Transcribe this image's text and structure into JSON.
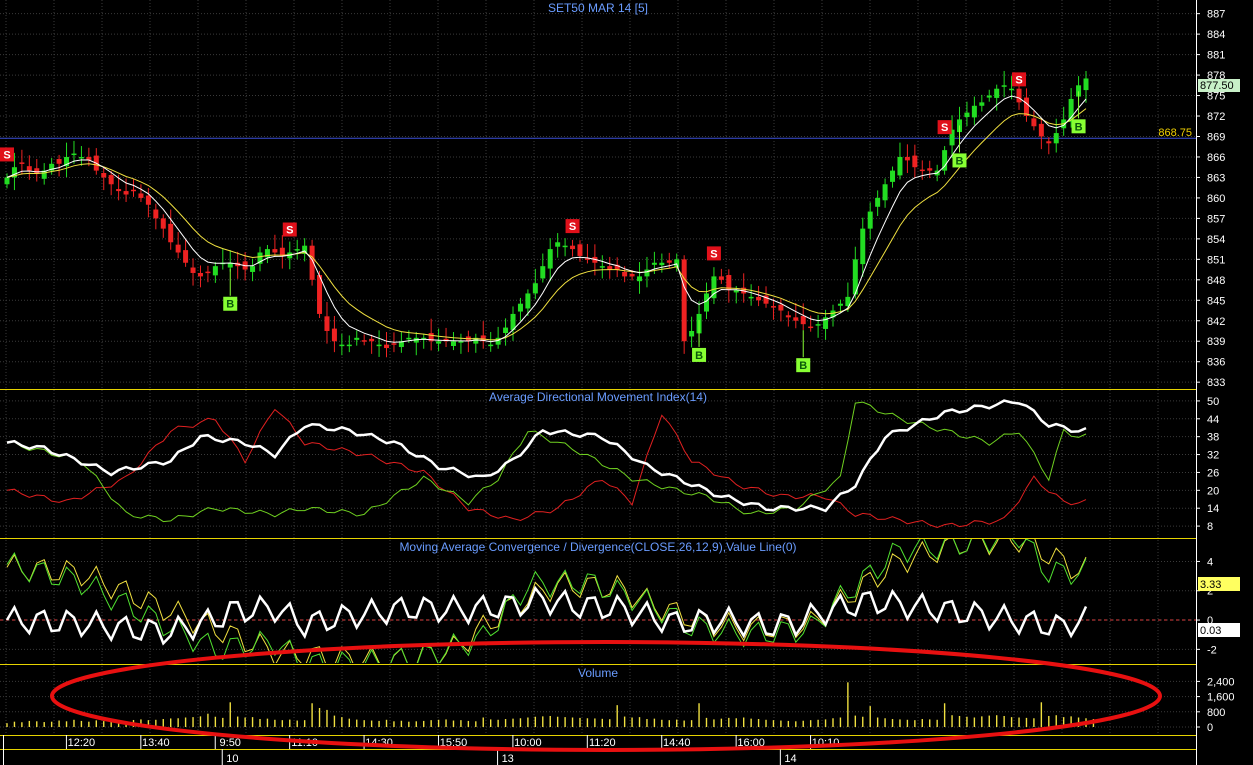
{
  "colors": {
    "background": "#000000",
    "grid": "#3a3a3a",
    "separator": "#e6d300",
    "bull": "#22dd22",
    "bear": "#ee2222",
    "ma_fast": "#ffffff",
    "ma_slow": "#f0e040",
    "title": "#6a9cff",
    "ref_line": "#3b4fd8",
    "sell_marker": "#e0101a",
    "buy_marker": "#88ff33",
    "highlight_ellipse": "#e81010",
    "price_tag_bg": "#c8f0c8",
    "macd_tag_bg": "#ffff60",
    "zero_tag_bg": "#ffffff"
  },
  "chart_data": [
    {
      "type": "candlestick",
      "panel": "price",
      "title": "SET50 MAR 14  [5]",
      "ylim": [
        832,
        889
      ],
      "yticks": [
        887,
        884,
        881,
        878,
        875,
        872,
        869,
        866,
        863,
        860,
        857,
        854,
        851,
        848,
        845,
        842,
        839,
        836,
        833
      ],
      "last_price_label": "877.50",
      "reference_level": 868.75,
      "reference_label": "868.75",
      "close": [
        863,
        864.5,
        865,
        864,
        863.5,
        864,
        865,
        865,
        866,
        866.5,
        866,
        865.5,
        864,
        863,
        862,
        861,
        860.5,
        861,
        860,
        859,
        857,
        855.5,
        853.5,
        852,
        850.5,
        849,
        848.5,
        849,
        850,
        850.5,
        850.5,
        850,
        849.5,
        850,
        852,
        852.5,
        852,
        851.5,
        852,
        852.5,
        853,
        848,
        843,
        840.5,
        839,
        838.5,
        838.5,
        839.5,
        839,
        839,
        838.5,
        838,
        838.5,
        839,
        839.5,
        839.5,
        839.5,
        839,
        839,
        839,
        839,
        839,
        839,
        839.5,
        839,
        838.5,
        839.5,
        841,
        843,
        844.5,
        846,
        847.5,
        850,
        852.5,
        853.5,
        853,
        852.5,
        851.5,
        851,
        850.5,
        850,
        849.5,
        849.5,
        848.5,
        848.5,
        848.5,
        849.5,
        850.5,
        850.5,
        850.5,
        851,
        839,
        840.5,
        843,
        846,
        848.5,
        848,
        846.5,
        846.5,
        846,
        845.5,
        845,
        844.5,
        844,
        843.5,
        842.5,
        842,
        841.5,
        841,
        841.5,
        842.5,
        843.5,
        844.5,
        845.5,
        851,
        855.5,
        858,
        860,
        862,
        864,
        866,
        865.5,
        864.5,
        864,
        864,
        864,
        867,
        870,
        871.5,
        872.5,
        873.5,
        874,
        875,
        876,
        876.5,
        876,
        874,
        872,
        870.5,
        869,
        868,
        869.5,
        871.5,
        874.5,
        876.5,
        877.5
      ],
      "volume": [
        200,
        280,
        250,
        320,
        300,
        260,
        280,
        340,
        300,
        380,
        320,
        280,
        350,
        310,
        390,
        340,
        310,
        370,
        400,
        360,
        380,
        420,
        450,
        460,
        500,
        520,
        560,
        700,
        540,
        480,
        1300,
        550,
        500,
        520,
        420,
        440,
        380,
        360,
        390,
        340,
        360,
        1250,
        1000,
        900,
        600,
        520,
        440,
        390,
        360,
        340,
        320,
        380,
        300,
        330,
        280,
        300,
        320,
        360,
        380,
        400,
        340,
        360,
        320,
        300,
        500,
        400,
        380,
        420,
        440,
        460,
        500,
        540,
        560,
        580,
        540,
        520,
        500,
        480,
        460,
        450,
        430,
        410,
        1150,
        550,
        500,
        520,
        420,
        440,
        380,
        360,
        390,
        340,
        360,
        1250,
        480,
        400,
        440,
        480,
        460,
        500,
        440,
        420,
        380,
        360,
        340,
        320,
        300,
        330,
        360,
        380,
        400,
        460,
        500,
        2350,
        600,
        540,
        1100,
        500,
        460,
        420,
        400,
        380,
        360,
        420,
        400,
        380,
        1250,
        620,
        580,
        540,
        500,
        560,
        600,
        620,
        580,
        520,
        500,
        480,
        460,
        1300,
        580,
        620,
        520,
        560,
        500,
        460,
        420
      ],
      "markers": [
        {
          "label": "S",
          "kind": "sell",
          "index": 0
        },
        {
          "label": "B",
          "kind": "buy",
          "index": 30
        },
        {
          "label": "S",
          "kind": "sell",
          "index": 38
        },
        {
          "label": "S",
          "kind": "sell",
          "index": 76
        },
        {
          "label": "S",
          "kind": "sell",
          "index": 95
        },
        {
          "label": "B",
          "kind": "buy",
          "index": 93
        },
        {
          "label": "B",
          "kind": "buy",
          "index": 107
        },
        {
          "label": "S",
          "kind": "sell",
          "index": 126
        },
        {
          "label": "B",
          "kind": "buy",
          "index": 128
        },
        {
          "label": "S",
          "kind": "sell",
          "index": 136
        },
        {
          "label": "B",
          "kind": "buy",
          "index": 144
        }
      ]
    },
    {
      "type": "line",
      "panel": "adx",
      "title": "Average Directional Movement Index(14)",
      "ylim": [
        4,
        54
      ],
      "yticks": [
        50,
        44,
        38,
        32,
        26,
        20,
        14,
        8
      ],
      "adx_keypoints": [
        [
          0,
          36
        ],
        [
          5,
          34
        ],
        [
          14,
          26
        ],
        [
          22,
          30
        ],
        [
          26,
          38
        ],
        [
          32,
          36
        ],
        [
          36,
          32
        ],
        [
          40,
          42
        ],
        [
          46,
          40
        ],
        [
          52,
          36
        ],
        [
          58,
          28
        ],
        [
          64,
          24
        ],
        [
          68,
          30
        ],
        [
          72,
          40
        ],
        [
          80,
          38
        ],
        [
          86,
          28
        ],
        [
          90,
          24
        ],
        [
          96,
          18
        ],
        [
          102,
          14
        ],
        [
          110,
          14
        ],
        [
          114,
          22
        ],
        [
          118,
          38
        ],
        [
          126,
          46
        ],
        [
          136,
          50
        ],
        [
          140,
          42
        ],
        [
          144,
          40
        ]
      ],
      "plus_di_keypoints": [
        [
          0,
          36
        ],
        [
          10,
          30
        ],
        [
          16,
          12
        ],
        [
          22,
          10
        ],
        [
          28,
          14
        ],
        [
          36,
          12
        ],
        [
          40,
          14
        ],
        [
          48,
          12
        ],
        [
          56,
          24
        ],
        [
          62,
          16
        ],
        [
          66,
          24
        ],
        [
          70,
          40
        ],
        [
          76,
          34
        ],
        [
          84,
          24
        ],
        [
          90,
          20
        ],
        [
          94,
          18
        ],
        [
          100,
          12
        ],
        [
          106,
          14
        ],
        [
          112,
          24
        ],
        [
          114,
          50
        ],
        [
          120,
          44
        ],
        [
          126,
          40
        ],
        [
          132,
          36
        ],
        [
          136,
          40
        ],
        [
          140,
          24
        ],
        [
          142,
          40
        ],
        [
          144,
          38
        ]
      ],
      "minus_di_keypoints": [
        [
          0,
          20
        ],
        [
          8,
          16
        ],
        [
          16,
          24
        ],
        [
          22,
          40
        ],
        [
          28,
          44
        ],
        [
          32,
          30
        ],
        [
          36,
          48
        ],
        [
          40,
          36
        ],
        [
          48,
          32
        ],
        [
          56,
          26
        ],
        [
          62,
          14
        ],
        [
          68,
          10
        ],
        [
          74,
          14
        ],
        [
          80,
          24
        ],
        [
          84,
          16
        ],
        [
          88,
          46
        ],
        [
          92,
          30
        ],
        [
          98,
          22
        ],
        [
          104,
          18
        ],
        [
          110,
          18
        ],
        [
          114,
          12
        ],
        [
          120,
          10
        ],
        [
          126,
          8
        ],
        [
          134,
          10
        ],
        [
          138,
          24
        ],
        [
          142,
          16
        ],
        [
          144,
          16
        ]
      ]
    },
    {
      "type": "line",
      "panel": "macd",
      "title": "Moving Average Convergence / Divergence(CLOSE,26,12,9),Value Line(0)",
      "ylim": [
        -3,
        5.6
      ],
      "yticks": [
        4,
        2,
        0,
        -2
      ],
      "zero_label": "0.03",
      "last_value_label": "3.33",
      "macd_keypoints": [
        [
          0,
          3.8
        ],
        [
          10,
          2.6
        ],
        [
          20,
          0
        ],
        [
          28,
          -2
        ],
        [
          36,
          -1.5
        ],
        [
          40,
          -3
        ],
        [
          48,
          -3
        ],
        [
          56,
          -2.5
        ],
        [
          64,
          -1.2
        ],
        [
          70,
          2.4
        ],
        [
          78,
          2.6
        ],
        [
          86,
          1.2
        ],
        [
          92,
          -0.5
        ],
        [
          100,
          -1
        ],
        [
          108,
          -0.6
        ],
        [
          112,
          1.5
        ],
        [
          120,
          4.8
        ],
        [
          126,
          5
        ],
        [
          136,
          5.8
        ],
        [
          140,
          3.2
        ],
        [
          144,
          3.3
        ]
      ],
      "signal_keypoints": [
        [
          0,
          3.6
        ],
        [
          10,
          3.2
        ],
        [
          20,
          1
        ],
        [
          28,
          -0.6
        ],
        [
          36,
          -2.2
        ],
        [
          44,
          -2.6
        ],
        [
          52,
          -2.8
        ],
        [
          60,
          -2
        ],
        [
          68,
          1
        ],
        [
          74,
          2.4
        ],
        [
          82,
          2.2
        ],
        [
          88,
          0.8
        ],
        [
          94,
          -0.2
        ],
        [
          100,
          -0.6
        ],
        [
          108,
          -0.3
        ],
        [
          114,
          2
        ],
        [
          120,
          4
        ],
        [
          128,
          5.2
        ],
        [
          136,
          5.5
        ],
        [
          144,
          3.4
        ]
      ],
      "histogram_keypoints": [
        [
          0,
          0
        ],
        [
          10,
          -0.2
        ],
        [
          16,
          -0.6
        ],
        [
          22,
          -0.8
        ],
        [
          28,
          0
        ],
        [
          30,
          0.6
        ],
        [
          36,
          0.8
        ],
        [
          40,
          -0.3
        ],
        [
          46,
          0.3
        ],
        [
          54,
          0.8
        ],
        [
          62,
          0.7
        ],
        [
          68,
          1
        ],
        [
          72,
          1.4
        ],
        [
          76,
          1
        ],
        [
          82,
          0.8
        ],
        [
          86,
          0.3
        ],
        [
          90,
          -0.2
        ],
        [
          96,
          0
        ],
        [
          102,
          -0.4
        ],
        [
          106,
          -0.2
        ],
        [
          110,
          0.6
        ],
        [
          116,
          1.3
        ],
        [
          124,
          0.8
        ],
        [
          130,
          0.4
        ],
        [
          134,
          0.1
        ],
        [
          138,
          -0.2
        ],
        [
          142,
          -0.5
        ],
        [
          144,
          0.03
        ]
      ]
    },
    {
      "type": "bar",
      "panel": "volume",
      "title": "Volume",
      "ylim": [
        0,
        3000
      ],
      "yticks": [
        "2,400",
        "1,600",
        "800",
        "0"
      ]
    }
  ],
  "x_axis": {
    "time_labels": [
      {
        "label": "12:20",
        "index": 10
      },
      {
        "label": "13:40",
        "index": 20
      },
      {
        "label": "9:50",
        "index": 30
      },
      {
        "label": "11:10",
        "index": 40
      },
      {
        "label": "14:30",
        "index": 50
      },
      {
        "label": "15:50",
        "index": 60
      },
      {
        "label": "10:00",
        "index": 70
      },
      {
        "label": "11:20",
        "index": 80
      },
      {
        "label": "14:40",
        "index": 90
      },
      {
        "label": "16:00",
        "index": 100
      },
      {
        "label": "10:10",
        "index": 110
      }
    ],
    "date_labels": [
      {
        "label": "10",
        "index": 30
      },
      {
        "label": "13",
        "index": 67
      },
      {
        "label": "14",
        "index": 105
      }
    ]
  }
}
